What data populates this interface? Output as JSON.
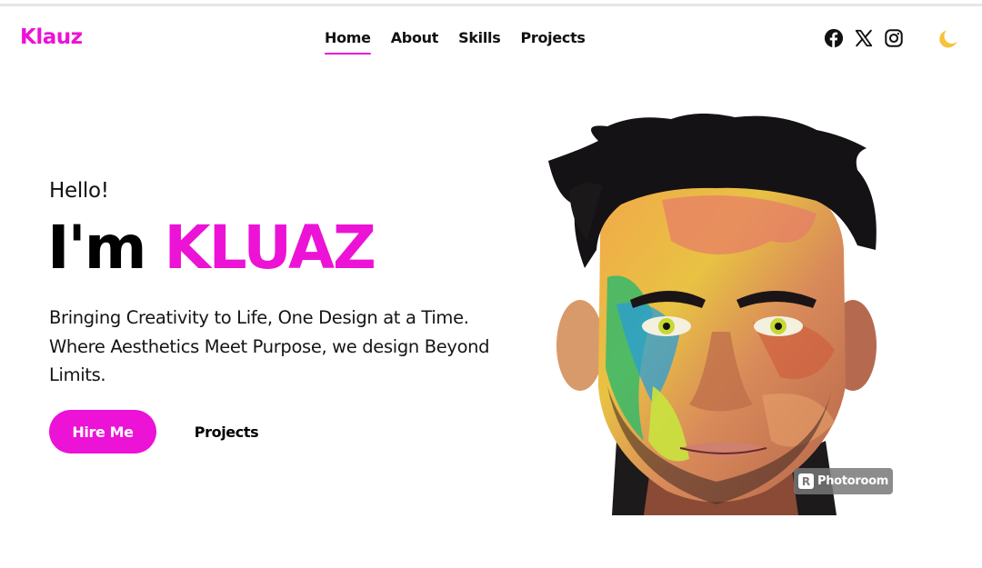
{
  "brand": {
    "logo": "Klauz",
    "accent": "#ec12d6"
  },
  "nav": {
    "items": [
      {
        "label": "Home",
        "active": true
      },
      {
        "label": "About",
        "active": false
      },
      {
        "label": "Skills",
        "active": false
      },
      {
        "label": "Projects",
        "active": false
      }
    ]
  },
  "social": [
    "facebook-icon",
    "x-icon",
    "instagram-icon"
  ],
  "theme_toggle": "moon-icon",
  "hero": {
    "greeting": "Hello!",
    "intro": "I'm",
    "name": "KLUAZ",
    "tagline": "Bringing Creativity to Life, One Design at a Time. Where Aesthetics Meet Purpose, we design Beyond Limits.",
    "primary_button": "Hire Me",
    "secondary_button": "Projects"
  },
  "portrait": {
    "watermark": "Photoroom",
    "watermark_mark": "R"
  }
}
